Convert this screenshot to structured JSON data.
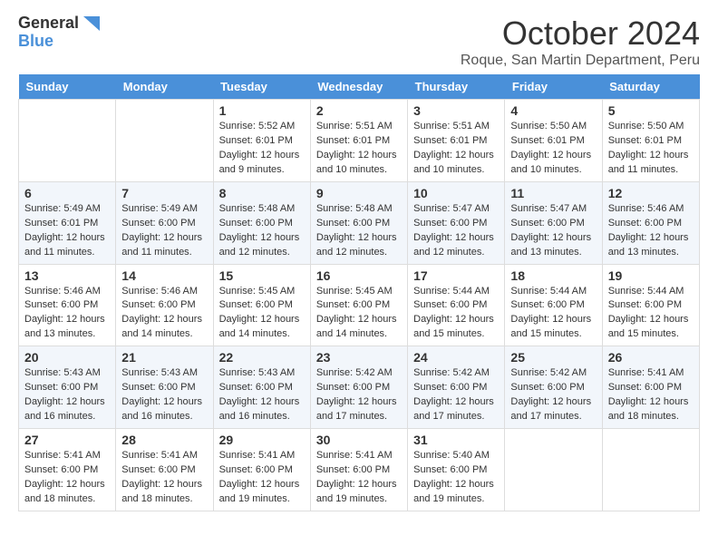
{
  "logo": {
    "line1": "General",
    "line2": "Blue"
  },
  "header": {
    "month": "October 2024",
    "location": "Roque, San Martin Department, Peru"
  },
  "weekdays": [
    "Sunday",
    "Monday",
    "Tuesday",
    "Wednesday",
    "Thursday",
    "Friday",
    "Saturday"
  ],
  "weeks": [
    [
      {
        "day": "",
        "info": ""
      },
      {
        "day": "",
        "info": ""
      },
      {
        "day": "1",
        "info": "Sunrise: 5:52 AM\nSunset: 6:01 PM\nDaylight: 12 hours and 9 minutes."
      },
      {
        "day": "2",
        "info": "Sunrise: 5:51 AM\nSunset: 6:01 PM\nDaylight: 12 hours and 10 minutes."
      },
      {
        "day": "3",
        "info": "Sunrise: 5:51 AM\nSunset: 6:01 PM\nDaylight: 12 hours and 10 minutes."
      },
      {
        "day": "4",
        "info": "Sunrise: 5:50 AM\nSunset: 6:01 PM\nDaylight: 12 hours and 10 minutes."
      },
      {
        "day": "5",
        "info": "Sunrise: 5:50 AM\nSunset: 6:01 PM\nDaylight: 12 hours and 11 minutes."
      }
    ],
    [
      {
        "day": "6",
        "info": "Sunrise: 5:49 AM\nSunset: 6:01 PM\nDaylight: 12 hours and 11 minutes."
      },
      {
        "day": "7",
        "info": "Sunrise: 5:49 AM\nSunset: 6:00 PM\nDaylight: 12 hours and 11 minutes."
      },
      {
        "day": "8",
        "info": "Sunrise: 5:48 AM\nSunset: 6:00 PM\nDaylight: 12 hours and 12 minutes."
      },
      {
        "day": "9",
        "info": "Sunrise: 5:48 AM\nSunset: 6:00 PM\nDaylight: 12 hours and 12 minutes."
      },
      {
        "day": "10",
        "info": "Sunrise: 5:47 AM\nSunset: 6:00 PM\nDaylight: 12 hours and 12 minutes."
      },
      {
        "day": "11",
        "info": "Sunrise: 5:47 AM\nSunset: 6:00 PM\nDaylight: 12 hours and 13 minutes."
      },
      {
        "day": "12",
        "info": "Sunrise: 5:46 AM\nSunset: 6:00 PM\nDaylight: 12 hours and 13 minutes."
      }
    ],
    [
      {
        "day": "13",
        "info": "Sunrise: 5:46 AM\nSunset: 6:00 PM\nDaylight: 12 hours and 13 minutes."
      },
      {
        "day": "14",
        "info": "Sunrise: 5:46 AM\nSunset: 6:00 PM\nDaylight: 12 hours and 14 minutes."
      },
      {
        "day": "15",
        "info": "Sunrise: 5:45 AM\nSunset: 6:00 PM\nDaylight: 12 hours and 14 minutes."
      },
      {
        "day": "16",
        "info": "Sunrise: 5:45 AM\nSunset: 6:00 PM\nDaylight: 12 hours and 14 minutes."
      },
      {
        "day": "17",
        "info": "Sunrise: 5:44 AM\nSunset: 6:00 PM\nDaylight: 12 hours and 15 minutes."
      },
      {
        "day": "18",
        "info": "Sunrise: 5:44 AM\nSunset: 6:00 PM\nDaylight: 12 hours and 15 minutes."
      },
      {
        "day": "19",
        "info": "Sunrise: 5:44 AM\nSunset: 6:00 PM\nDaylight: 12 hours and 15 minutes."
      }
    ],
    [
      {
        "day": "20",
        "info": "Sunrise: 5:43 AM\nSunset: 6:00 PM\nDaylight: 12 hours and 16 minutes."
      },
      {
        "day": "21",
        "info": "Sunrise: 5:43 AM\nSunset: 6:00 PM\nDaylight: 12 hours and 16 minutes."
      },
      {
        "day": "22",
        "info": "Sunrise: 5:43 AM\nSunset: 6:00 PM\nDaylight: 12 hours and 16 minutes."
      },
      {
        "day": "23",
        "info": "Sunrise: 5:42 AM\nSunset: 6:00 PM\nDaylight: 12 hours and 17 minutes."
      },
      {
        "day": "24",
        "info": "Sunrise: 5:42 AM\nSunset: 6:00 PM\nDaylight: 12 hours and 17 minutes."
      },
      {
        "day": "25",
        "info": "Sunrise: 5:42 AM\nSunset: 6:00 PM\nDaylight: 12 hours and 17 minutes."
      },
      {
        "day": "26",
        "info": "Sunrise: 5:41 AM\nSunset: 6:00 PM\nDaylight: 12 hours and 18 minutes."
      }
    ],
    [
      {
        "day": "27",
        "info": "Sunrise: 5:41 AM\nSunset: 6:00 PM\nDaylight: 12 hours and 18 minutes."
      },
      {
        "day": "28",
        "info": "Sunrise: 5:41 AM\nSunset: 6:00 PM\nDaylight: 12 hours and 18 minutes."
      },
      {
        "day": "29",
        "info": "Sunrise: 5:41 AM\nSunset: 6:00 PM\nDaylight: 12 hours and 19 minutes."
      },
      {
        "day": "30",
        "info": "Sunrise: 5:41 AM\nSunset: 6:00 PM\nDaylight: 12 hours and 19 minutes."
      },
      {
        "day": "31",
        "info": "Sunrise: 5:40 AM\nSunset: 6:00 PM\nDaylight: 12 hours and 19 minutes."
      },
      {
        "day": "",
        "info": ""
      },
      {
        "day": "",
        "info": ""
      }
    ]
  ]
}
